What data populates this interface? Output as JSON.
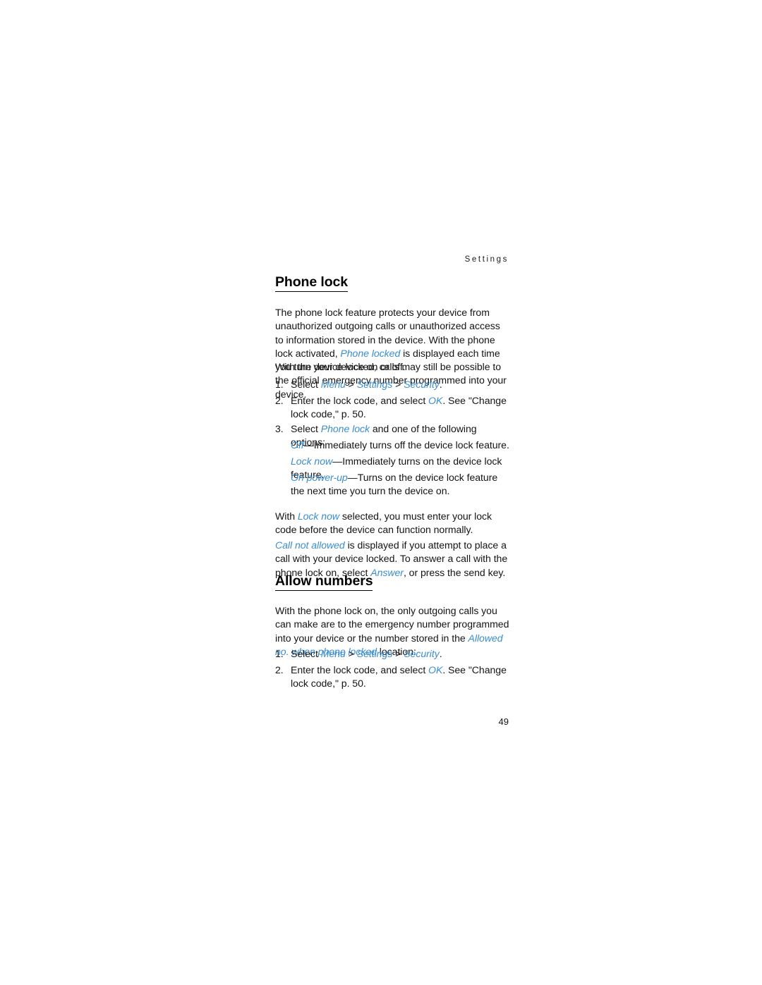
{
  "page": {
    "running_header": "Settings",
    "folio": "49"
  },
  "sections": [
    {
      "heading": "Phone lock",
      "paragraphs": {
        "intro_1": "The phone lock feature protects your device from unauthorized outgoing calls or unauthorized access to information stored in the device. With the phone lock activated, ",
        "intro_1_ui": "Phone locked",
        "intro_1_tail": " is displayed each time you turn your device on or off.",
        "intro_2": "With the device locked, calls may still be possible to the official emergency number programmed into your device.",
        "lock_now_note_head": "With ",
        "lock_now_note_ui": "Lock now",
        "lock_now_note_tail": " selected, you must enter your lock code before the device can function normally.",
        "call_not_allowed_ui": "Call not allowed",
        "call_not_allowed_mid": " is displayed if you attempt to place a call with your device locked. To answer a call with the phone lock on, select ",
        "call_not_allowed_ui2": "Answer",
        "call_not_allowed_tail": ", or press the send key."
      },
      "steps": [
        {
          "num": "1.",
          "pre": "Select ",
          "ui1": "Menu",
          "sep1": " > ",
          "ui2": "Settings",
          "sep2": " > ",
          "ui3": "Security",
          "tail": "."
        },
        {
          "num": "2.",
          "pre": "Enter the lock code, and select ",
          "ui1": "OK",
          "tail": ". See \"Change lock code,\" p. 50."
        },
        {
          "num": "3.",
          "pre": "Select ",
          "ui1": "Phone lock",
          "tail": " and one of the following options:"
        }
      ],
      "options": [
        {
          "ui": "Off",
          "text": "—Immediately turns off the device lock feature."
        },
        {
          "ui": "Lock now",
          "text": "—Immediately turns on the device lock feature."
        },
        {
          "ui": "On power-up",
          "text": "—Turns on the device lock feature the next time you turn the device on."
        }
      ]
    },
    {
      "heading": "Allow numbers",
      "paragraphs": {
        "intro_head": "With the phone lock on, the only outgoing calls you can make are to the emergency number programmed into your device or the number stored in the ",
        "intro_ui": "Allowed no. when phone locked",
        "intro_tail": " location:"
      },
      "steps": [
        {
          "num": "1.",
          "pre": "Select ",
          "ui1": "Menu",
          "sep1": " > ",
          "ui2": "Settings",
          "sep2": " > ",
          "ui3": "Security",
          "tail": "."
        },
        {
          "num": "2.",
          "pre": "Enter the lock code, and select ",
          "ui1": "OK",
          "tail": ". See \"Change lock code,\" p. 50."
        }
      ]
    }
  ],
  "colors": {
    "ui_term_blue": "#3a8dd0",
    "body_text": "#141414",
    "page_background": "#ffffff"
  }
}
